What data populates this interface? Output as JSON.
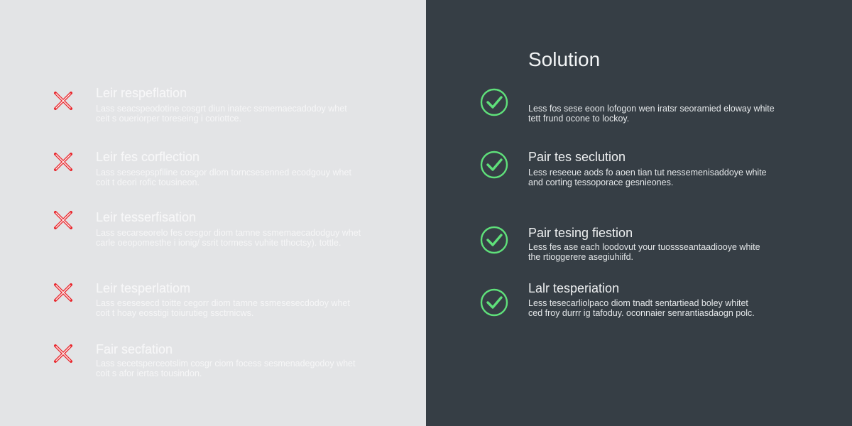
{
  "colors": {
    "left_bg": "#e3e4e6",
    "right_bg": "#363e45",
    "problem_accent": "#e8252b",
    "solution_accent": "#5fe07a"
  },
  "right_panel": {
    "title": "Solution"
  },
  "problems": [
    {
      "icon": "cross-icon",
      "title": "Leir respeflation",
      "desc_line1": "Lass seacspeodotine cosgrt diun inatec ssmemaecadodoy whet",
      "desc_line2": "ceit s oueriorper toreseing i coriottce."
    },
    {
      "icon": "cross-icon",
      "title": "Leir fes corflection",
      "desc_line1": "Lass sesesepspfiline cosgor dlom torncsesenned ecodgouy whet",
      "desc_line2": "coit t deori rofic tousineon."
    },
    {
      "icon": "cross-icon",
      "title": "Leir tesserfisation",
      "desc_line1": "Lass secarseorelo fes cesgor diom tamne ssmemaecadodguy whet",
      "desc_line2": "carle oeopomesthe i ionig/ ssrit tormess vuhite tthoctsy). tottle."
    },
    {
      "icon": "cross-icon",
      "title": "Leir tesperlatiom",
      "desc_line1": "Lass esesesecd toitte cegorr diom tamne ssmesesecdodoy whet",
      "desc_line2": "coit t hoay eosstigi toiurutieg ssctrnicws."
    },
    {
      "icon": "cross-icon",
      "title": "Fair secfation",
      "desc_line1": "Lass secetsperceotslim cosgr ciom focess sesmenadegodoy whet",
      "desc_line2": "coit s afor iertas tousindon."
    }
  ],
  "solutions": [
    {
      "icon": "checkmark-icon",
      "title": "",
      "desc_line1": "Less fos sese eoon lofogon wen iratsr seoramied eloway white",
      "desc_line2": "tett frund ocone to lockoy."
    },
    {
      "icon": "checkmark-icon",
      "title": "Pair tes seclution",
      "desc_line1": "Less reseeue aods fo aoen tian tut nessemenisaddoye white",
      "desc_line2": "and corting tessoporace gesnieones."
    },
    {
      "icon": "checkmark-icon",
      "title": "Pair tesing fiestion",
      "desc_line1": "Less fes ase each loodovut your tuossseantaadiooye white",
      "desc_line2": "the rtioggerere asegiuhiifd."
    },
    {
      "icon": "checkmark-icon",
      "title": "Lalr tesperiation",
      "desc_line1": "Less tesecarliolpaco diom tnadt sentartiead boley whitet",
      "desc_line2": "ced froy durrr ig tafoduy. oconnaier senrantiasdaogn polc."
    }
  ]
}
